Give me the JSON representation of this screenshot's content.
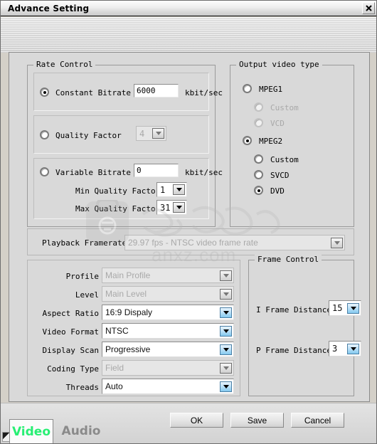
{
  "window": {
    "title": "Advance Setting",
    "close_icon": "close-icon"
  },
  "tabs": [
    {
      "label": "Video",
      "active": true
    },
    {
      "label": "Audio",
      "active": false
    }
  ],
  "rate_control": {
    "legend": "Rate Control",
    "constant_bitrate": {
      "label": "Constant Bitrate",
      "selected": true,
      "value": "6000",
      "unit": "kbit/sec"
    },
    "quality_factor": {
      "label": "Quality Factor",
      "selected": false,
      "value": "4"
    },
    "variable_bitrate": {
      "label": "Variable Bitrate",
      "selected": false,
      "value": "0",
      "unit": "kbit/sec"
    },
    "min_quality_factor": {
      "label": "Min Quality Factor",
      "value": "1"
    },
    "max_quality_factor": {
      "label": "Max Quality Factor",
      "value": "31"
    }
  },
  "output_video_type": {
    "legend": "Output video type",
    "mpeg1": {
      "label": "MPEG1",
      "selected": false
    },
    "mpeg1_custom": {
      "label": "Custom",
      "selected": false,
      "disabled": true
    },
    "mpeg1_vcd": {
      "label": "VCD",
      "selected": false,
      "disabled": true
    },
    "mpeg2": {
      "label": "MPEG2",
      "selected": true
    },
    "mpeg2_custom": {
      "label": "Custom",
      "selected": false
    },
    "mpeg2_svcd": {
      "label": "SVCD",
      "selected": false
    },
    "mpeg2_dvd": {
      "label": "DVD",
      "selected": true
    }
  },
  "playback_framerate": {
    "label": "Playback Framerate",
    "value": "29.97 fps - NTSC video frame rate"
  },
  "video_settings": [
    {
      "label": "Profile",
      "value": "Main Profile",
      "enabled": false
    },
    {
      "label": "Level",
      "value": "Main Level",
      "enabled": false
    },
    {
      "label": "Aspect Ratio",
      "value": "16:9 Dispaly",
      "enabled": true
    },
    {
      "label": "Video Format",
      "value": "NTSC",
      "enabled": true
    },
    {
      "label": "Display Scan",
      "value": "Progressive",
      "enabled": true
    },
    {
      "label": "Coding Type",
      "value": "Field",
      "enabled": false
    },
    {
      "label": "Threads",
      "value": "Auto",
      "enabled": true
    }
  ],
  "frame_control": {
    "legend": "Frame Control",
    "i_frame_distance": {
      "label": "I Frame Distance",
      "value": "15"
    },
    "p_frame_distance": {
      "label": "P Frame Distance",
      "value": "3"
    }
  },
  "buttons": {
    "ok": "OK",
    "save": "Save",
    "cancel": "Cancel"
  },
  "watermark": {
    "text": "anxz.com"
  }
}
